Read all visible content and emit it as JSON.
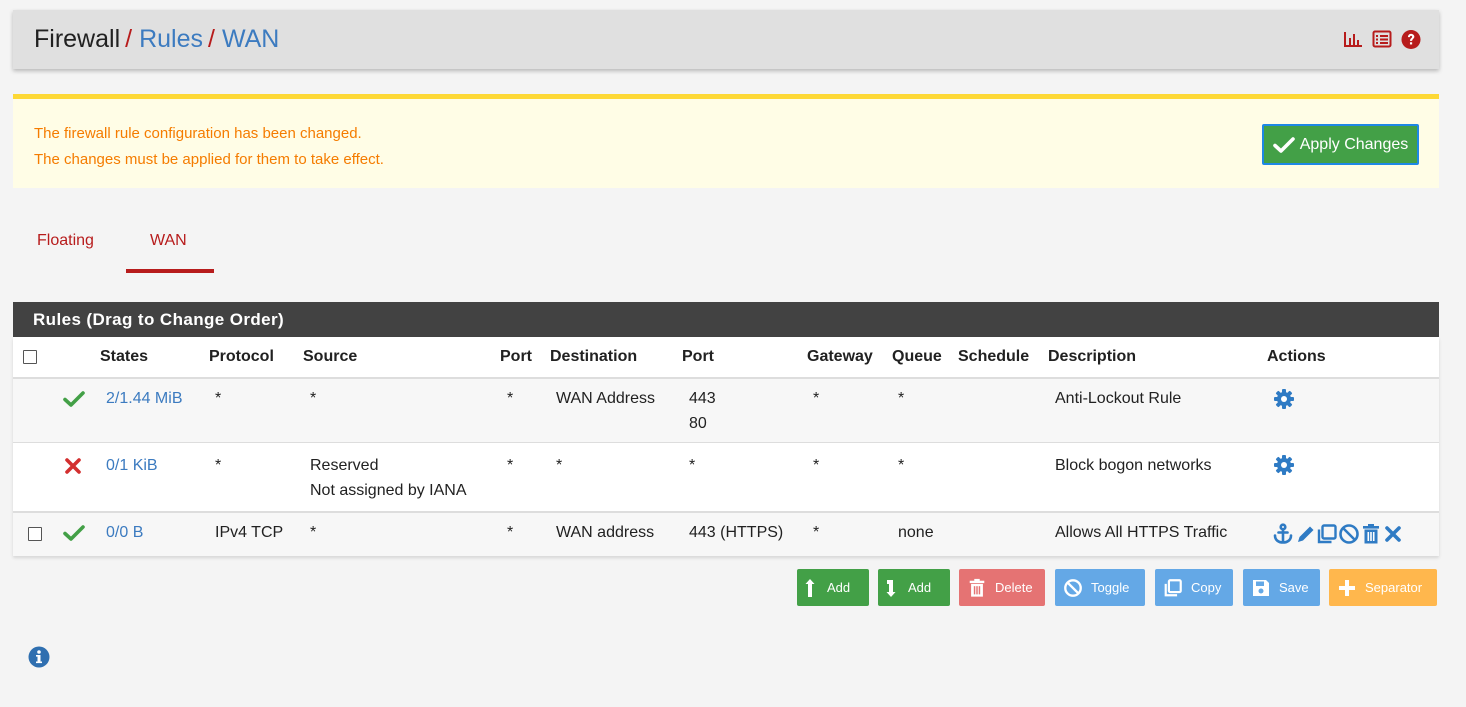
{
  "breadcrumb": {
    "part1": "Firewall",
    "sep": "/",
    "part2": "Rules",
    "part3": "WAN"
  },
  "header_icons": [
    "chart-icon",
    "list-icon",
    "help-icon"
  ],
  "alert": {
    "line1": "The firewall rule configuration has been changed.",
    "line2": "The changes must be applied for them to take effect.",
    "apply_label": "Apply Changes"
  },
  "tabs": [
    {
      "label": "Floating",
      "active": false
    },
    {
      "label": "WAN",
      "active": true
    }
  ],
  "panel": {
    "title": "Rules (Drag to Change Order)"
  },
  "columns": [
    "States",
    "Protocol",
    "Source",
    "Port",
    "Destination",
    "Port",
    "Gateway",
    "Queue",
    "Schedule",
    "Description",
    "Actions"
  ],
  "rows": [
    {
      "status": "pass",
      "states": "2/1.44 MiB",
      "protocol": "*",
      "source_line1": "*",
      "source_line2": "",
      "src_port": "*",
      "destination": "WAN Address",
      "dst_port_line1": "443",
      "dst_port_line2": "80",
      "gateway": "*",
      "queue": "*",
      "schedule": "",
      "description": "Anti-Lockout Rule",
      "actions": [
        "gear-icon"
      ]
    },
    {
      "status": "block",
      "states": "0/1 KiB",
      "protocol": "*",
      "source_line1": "Reserved",
      "source_line2": "Not assigned by IANA",
      "src_port": "*",
      "destination": "*",
      "dst_port_line1": "*",
      "dst_port_line2": "",
      "gateway": "*",
      "queue": "*",
      "schedule": "",
      "description": "Block bogon networks",
      "actions": [
        "gear-icon"
      ]
    },
    {
      "status": "pass",
      "states": "0/0 B",
      "protocol": "IPv4 TCP",
      "source_line1": "*",
      "source_line2": "",
      "src_port": "*",
      "destination": "WAN address",
      "dst_port_line1": "443 (HTTPS)",
      "dst_port_line2": "",
      "gateway": "*",
      "queue": "none",
      "schedule": "",
      "description": "Allows All HTTPS Traffic",
      "actions": [
        "anchor-icon",
        "pencil-icon",
        "copy-icon",
        "disable-icon",
        "trash-icon",
        "delete-x-icon"
      ]
    }
  ],
  "buttons": [
    {
      "label": "Add",
      "icon": "arrow-up-icon",
      "color": "#43a047"
    },
    {
      "label": "Add",
      "icon": "arrow-down-icon",
      "color": "#43a047"
    },
    {
      "label": "Delete",
      "icon": "trash-icon",
      "color": "#e57373"
    },
    {
      "label": "Toggle",
      "icon": "ban-icon",
      "color": "#64a8e6"
    },
    {
      "label": "Copy",
      "icon": "copy-icon",
      "color": "#64a8e6"
    },
    {
      "label": "Save",
      "icon": "save-icon",
      "color": "#64a8e6"
    },
    {
      "label": "Separator",
      "icon": "plus-icon",
      "color": "#ffb74d"
    }
  ],
  "colors": {
    "accent_red": "#b71c1c",
    "link_blue": "#3c7bc0",
    "pass_green": "#43a047",
    "block_red": "#d32f2f",
    "alert_text": "#f57c00"
  }
}
